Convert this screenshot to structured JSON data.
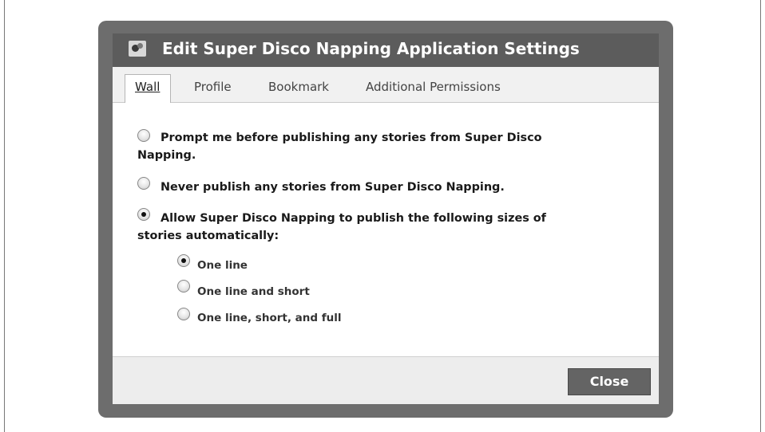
{
  "dialog": {
    "title": "Edit Super Disco Napping Application Settings",
    "icon": "app-icon"
  },
  "tabs": [
    {
      "label": "Wall",
      "active": true
    },
    {
      "label": "Profile",
      "active": false
    },
    {
      "label": "Bookmark",
      "active": false
    },
    {
      "label": "Additional Permissions",
      "active": false
    }
  ],
  "options": [
    {
      "line1": "Prompt me before publishing any stories from Super Disco",
      "line2": "Napping.",
      "selected": false
    },
    {
      "line1": "Never publish any stories from Super Disco Napping.",
      "selected": false
    },
    {
      "line1": "Allow Super Disco Napping to publish the following sizes of",
      "line2": "stories automatically:",
      "selected": true
    }
  ],
  "sizes": [
    {
      "label": "One line",
      "selected": true
    },
    {
      "label": "One line and short",
      "selected": false
    },
    {
      "label": "One line, short, and full",
      "selected": false
    }
  ],
  "footer": {
    "close_label": "Close"
  },
  "colors": {
    "titlebar": "#5c5c5c",
    "dialog_border": "#6d6d6d",
    "button": "#646464"
  }
}
